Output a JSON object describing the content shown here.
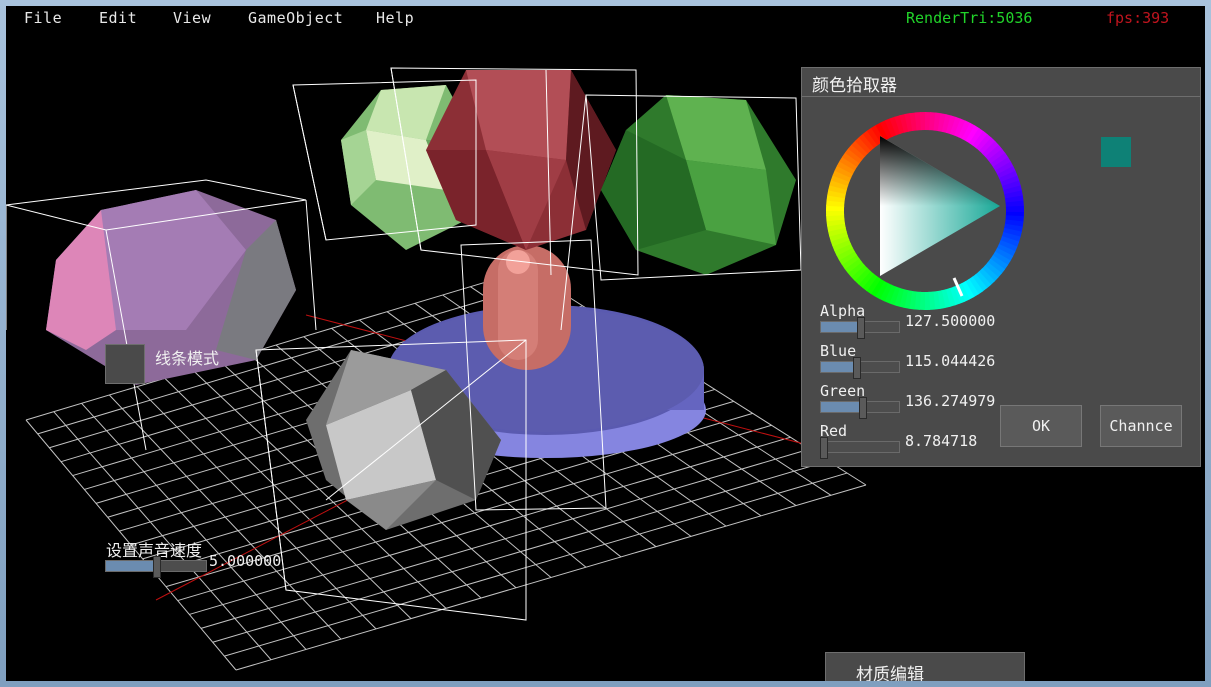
{
  "menu": {
    "items": [
      {
        "label": "File"
      },
      {
        "label": "Edit"
      },
      {
        "label": "View"
      },
      {
        "label": "GameObject"
      },
      {
        "label": "Help"
      }
    ]
  },
  "stats": {
    "render_tri": "RenderTri:5036",
    "fps": "fps:393",
    "render_tri_color": "#21d32a",
    "fps_color": "#c0141e"
  },
  "wireframe_toggle": {
    "label": "线条模式"
  },
  "sound_speed": {
    "label": "设置声音速度",
    "value_text": "5.000000",
    "level": 0.5
  },
  "color_picker": {
    "title": "颜色拾取器",
    "selected_color": "#0e8176",
    "channels": [
      {
        "label": "Alpha",
        "value_text": "127.500000",
        "level": 0.5
      },
      {
        "label": "Blue",
        "value_text": "115.044426",
        "level": 0.45
      },
      {
        "label": "Green",
        "value_text": "136.274979",
        "level": 0.53
      },
      {
        "label": "Red",
        "value_text": "8.784718",
        "level": 0.03
      }
    ],
    "ok_label": "OK",
    "cancel_label": "Channce"
  },
  "material_tab": {
    "label": "材质编辑"
  },
  "scene": {
    "grid_color": "#d8d8d8",
    "axis_color": "#c01010",
    "objects": [
      {
        "name": "pink-hexagonal-prism",
        "color": "#b085c0"
      },
      {
        "name": "light-green-icosahedron",
        "color": "#9bd08a"
      },
      {
        "name": "dark-red-icosahedron",
        "color": "#9a3a40"
      },
      {
        "name": "green-icosahedron",
        "color": "#3e9a3a"
      },
      {
        "name": "salmon-capsule",
        "color": "#d97f76"
      },
      {
        "name": "blue-disc",
        "color": "#6a6ec8"
      },
      {
        "name": "gray-icosahedron",
        "color": "#a0a0a0"
      }
    ]
  }
}
